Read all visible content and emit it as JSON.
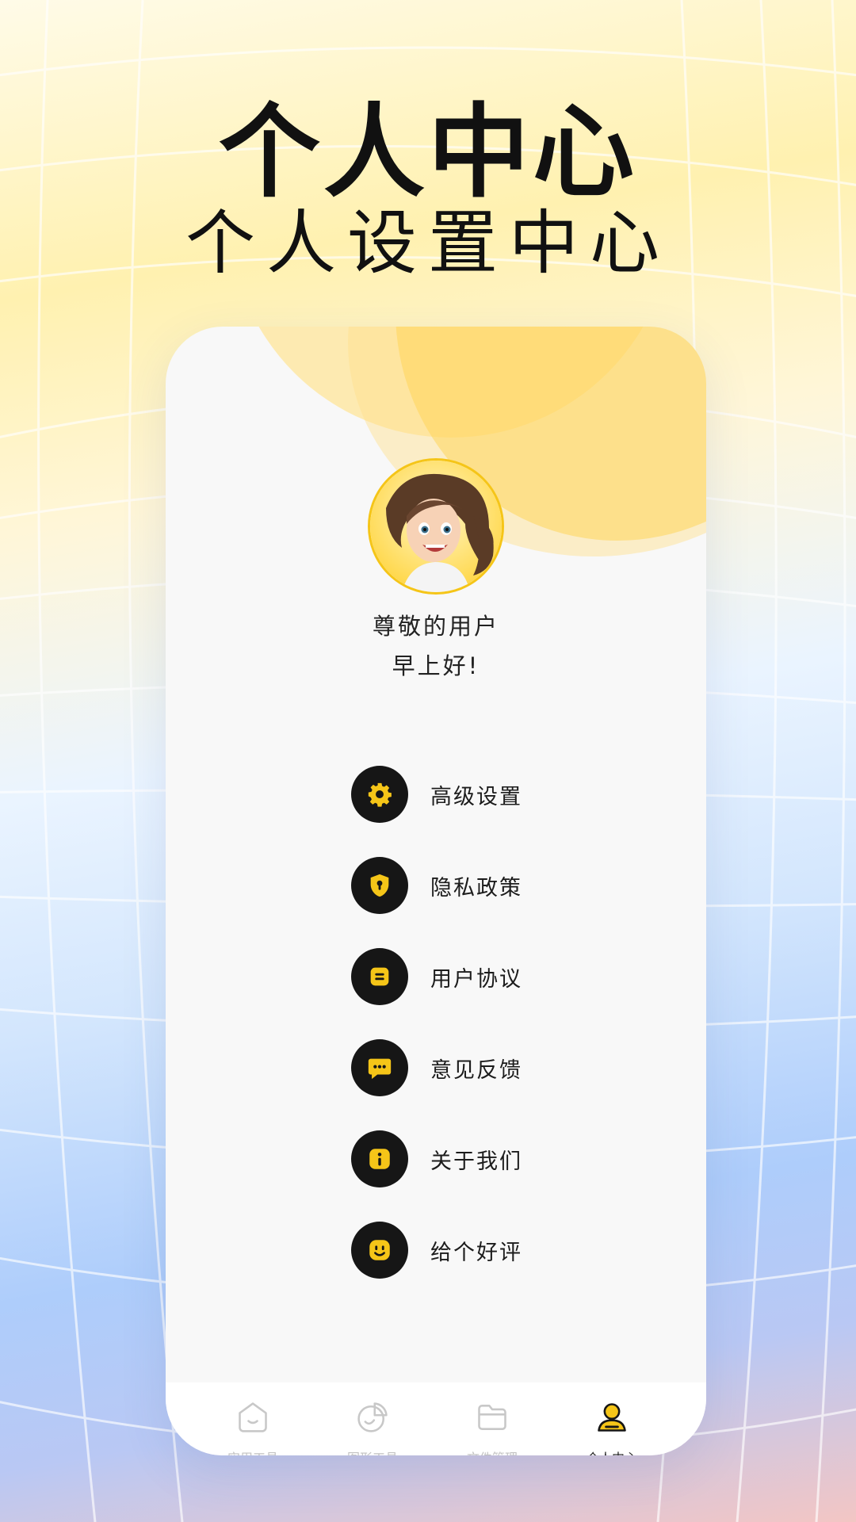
{
  "headline": {
    "title": "个人中心",
    "subtitle": "个人设置中心"
  },
  "profile": {
    "name": "尊敬的用户",
    "greeting": "早上好!"
  },
  "menu": {
    "items": [
      {
        "label": "高级设置",
        "icon": "gear-icon"
      },
      {
        "label": "隐私政策",
        "icon": "shield-lock-icon"
      },
      {
        "label": "用户协议",
        "icon": "document-icon"
      },
      {
        "label": "意见反馈",
        "icon": "chat-bubble-icon"
      },
      {
        "label": "关于我们",
        "icon": "info-icon"
      },
      {
        "label": "给个好评",
        "icon": "smile-icon"
      }
    ]
  },
  "tabbar": {
    "active_index": 3,
    "tabs": [
      {
        "label": "实用工具",
        "icon": "home-icon"
      },
      {
        "label": "图形工具",
        "icon": "pie-chart-icon"
      },
      {
        "label": "文件管理",
        "icon": "folder-icon"
      },
      {
        "label": "个人中心",
        "icon": "user-icon"
      }
    ]
  },
  "colors": {
    "accent": "#F5C518",
    "icon_bg": "#161616",
    "tab_inactive": "#C2C2C2",
    "blob": "#FFD65A"
  }
}
